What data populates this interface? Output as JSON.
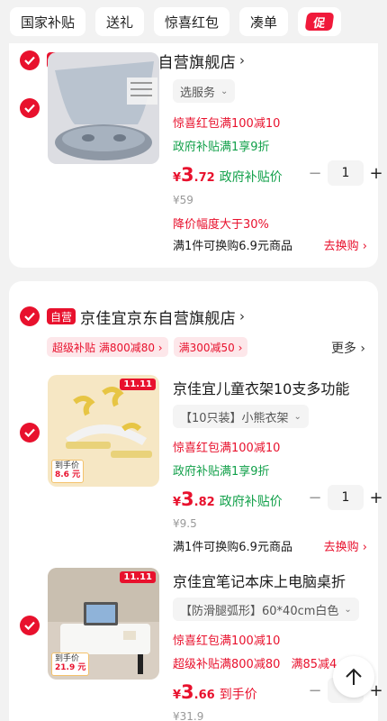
{
  "tabs": [
    "国家补贴",
    "送礼",
    "惊喜红包",
    "凑单"
  ],
  "promo_tab": "促",
  "stores": [
    {
      "self_tag": "自营",
      "name": "安纳福京东自营旗舰店",
      "items": [
        {
          "spec": "选服务",
          "red_packet": "惊喜红包满100减10",
          "gov_subsidy": "政府补贴满1享9折",
          "price_currency": "¥",
          "price_int": "3",
          "price_dec": ".72",
          "price_tag": "政府补贴价",
          "qty": "1",
          "orig_price": "¥59",
          "drop_note": "降价幅度大于30%",
          "bundle": "满1件可换购6.9元商品",
          "bundle_action": "去换购 ›"
        }
      ]
    },
    {
      "self_tag": "自营",
      "name": "京佳宜京东自营旗舰店",
      "promos": [
        "超级补贴 满800减80 ›",
        "满300减50 ›"
      ],
      "more": "更多 ›",
      "items": [
        {
          "title": "京佳宜儿童衣架10支多功能",
          "spec": "【10只装】小熊衣架",
          "red_packet": "惊喜红包满100减10",
          "gov_subsidy": "政府补贴满1享9折",
          "price_currency": "¥",
          "price_int": "3",
          "price_dec": ".82",
          "price_tag": "政府补贴价",
          "qty": "1",
          "orig_price": "¥9.5",
          "bundle": "满1件可换购6.9元商品",
          "bundle_action": "去换购 ›",
          "image_badge": "11.11",
          "image_price_label": "到手价",
          "image_price": "8.6 元"
        },
        {
          "title": "京佳宜笔记本床上电脑桌折",
          "spec": "【防滑腿弧形】60*40cm白色",
          "red_packet": "惊喜红包满100减10",
          "super_subsidy": "超级补贴满800减80",
          "discount": "满85减4",
          "price_currency": "¥",
          "price_int": "3",
          "price_dec": ".66",
          "price_tag": "到手价",
          "qty": "1",
          "orig_price": "¥31.9",
          "image_badge": "11.11",
          "image_price_label": "到手价",
          "image_price": "21.9 元"
        }
      ]
    }
  ],
  "colors": {
    "accent": "#e8112d",
    "green": "#12a04a",
    "tag_bg": "#fde7ea"
  },
  "icons": {
    "check": "checkmark-icon",
    "scroll_top": "arrow-up-icon"
  }
}
